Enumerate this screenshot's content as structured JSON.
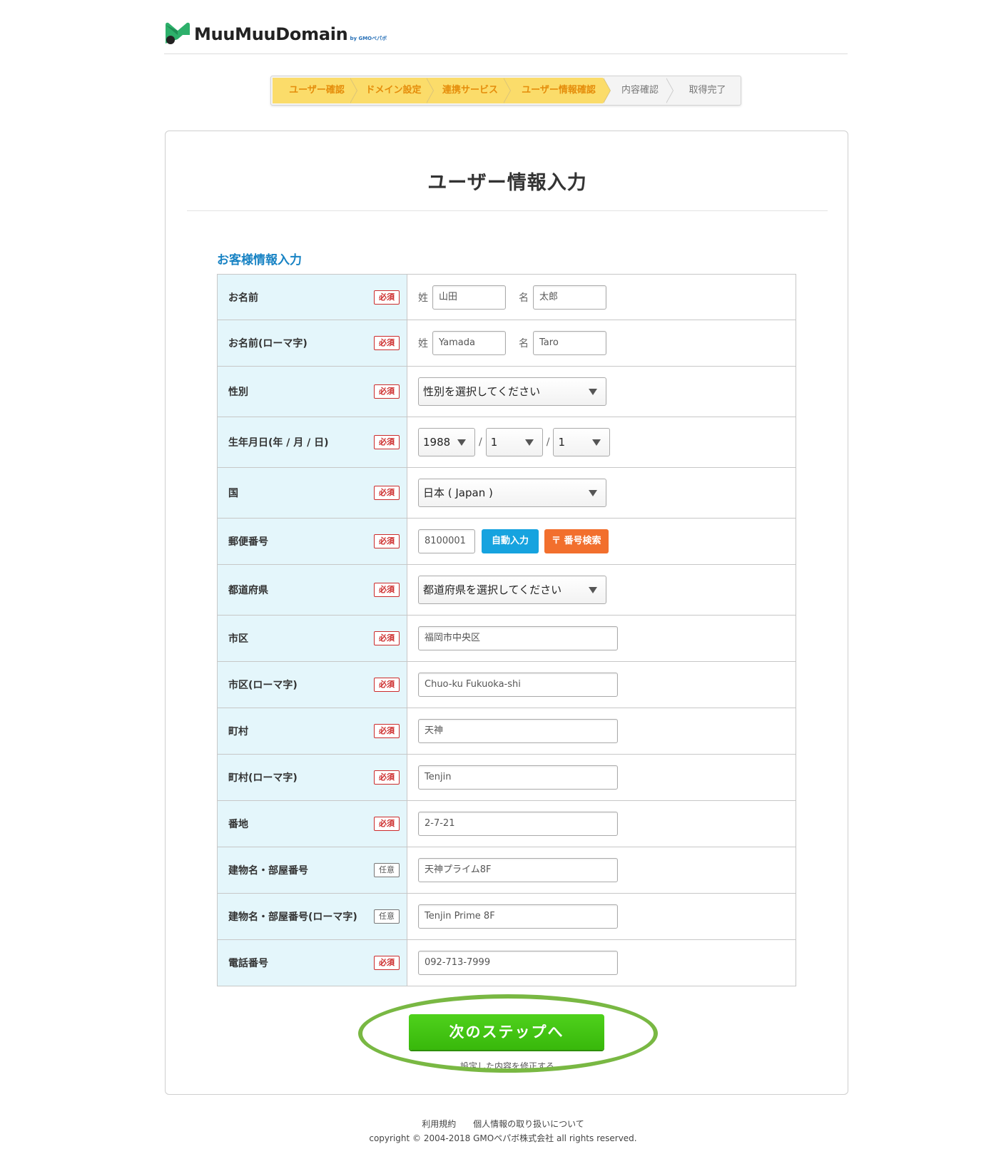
{
  "header": {
    "brand": "MuuMuuDomain",
    "brand_by": "by GMOペパボ",
    "colors": {
      "brand_green": "#2db06b",
      "brand_dark": "#222222"
    }
  },
  "steps": [
    {
      "label": "ユーザー確認",
      "state": "done"
    },
    {
      "label": "ドメイン設定",
      "state": "done"
    },
    {
      "label": "連携サービス",
      "state": "done"
    },
    {
      "label": "ユーザー情報確認",
      "state": "current"
    },
    {
      "label": "内容確認",
      "state": "pending"
    },
    {
      "label": "取得完了",
      "state": "pending"
    }
  ],
  "page": {
    "title": "ユーザー情報入力",
    "section_title": "お客様情報入力"
  },
  "badges": {
    "required": "必須",
    "optional": "任意"
  },
  "form": {
    "name": {
      "label": "お名前",
      "last_prefix": "姓",
      "last_value": "山田",
      "first_prefix": "名",
      "first_value": "太郎"
    },
    "name_roman": {
      "label": "お名前(ローマ字)",
      "last_prefix": "姓",
      "last_value": "Yamada",
      "first_prefix": "名",
      "first_value": "Taro"
    },
    "gender": {
      "label": "性別",
      "selected": "性別を選択してください"
    },
    "birthdate": {
      "label": "生年月日(年 / 月 / 日)",
      "year": "1988",
      "month": "1",
      "day": "1",
      "separator": "/"
    },
    "country": {
      "label": "国",
      "selected": "日本 ( Japan )"
    },
    "postal": {
      "label": "郵便番号",
      "value": "8100001",
      "auto_button": "自動入力",
      "search_button": "〒 番号検索"
    },
    "prefecture": {
      "label": "都道府県",
      "selected": "都道府県を選択してください"
    },
    "city": {
      "label": "市区",
      "value": "福岡市中央区"
    },
    "city_roman": {
      "label": "市区(ローマ字)",
      "value": "Chuo-ku Fukuoka-shi"
    },
    "town": {
      "label": "町村",
      "value": "天神"
    },
    "town_roman": {
      "label": "町村(ローマ字)",
      "value": "Tenjin"
    },
    "street": {
      "label": "番地",
      "value": "2-7-21"
    },
    "building": {
      "label": "建物名・部屋番号",
      "value": "天神プライム8F"
    },
    "building_roman": {
      "label": "建物名・部屋番号(ローマ字)",
      "value": "Tenjin Prime 8F"
    },
    "phone": {
      "label": "電話番号",
      "value": "092-713-7999"
    }
  },
  "actions": {
    "next_button": "次のステップへ",
    "back_link": "設定した内容を修正する",
    "colors": {
      "next_green": "#3fc212",
      "highlight_ring": "#79b843"
    }
  },
  "footer": {
    "links": [
      "利用規約",
      "個人情報の取り扱いについて"
    ],
    "copyright": "copyright © 2004-2018 GMOペパボ株式会社 all rights reserved."
  }
}
